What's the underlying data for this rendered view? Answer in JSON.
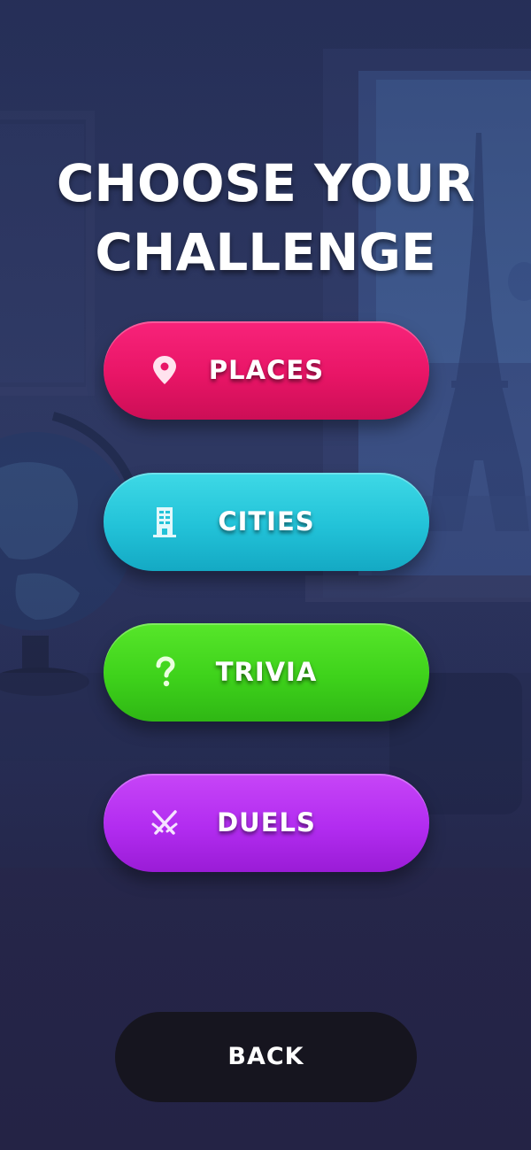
{
  "screen": {
    "title_line1": "CHOOSE YOUR",
    "title_line2": "CHALLENGE"
  },
  "menu": {
    "items": [
      {
        "label": "PLACES",
        "icon": "map-pin-icon",
        "color": "#e81566"
      },
      {
        "label": "CITIES",
        "icon": "building-icon",
        "color": "#22c2d8"
      },
      {
        "label": "TRIVIA",
        "icon": "question-mark-icon",
        "color": "#3ed21b"
      },
      {
        "label": "DUELS",
        "icon": "crossed-swords-icon",
        "color": "#b22cf0"
      }
    ]
  },
  "back": {
    "label": "BACK"
  },
  "colors": {
    "background": "#2f3a66",
    "title_text": "#ffffff",
    "back_button": "#16151f"
  }
}
